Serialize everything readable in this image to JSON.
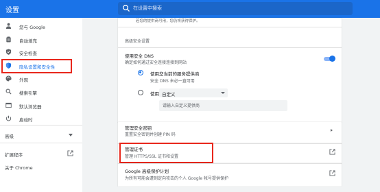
{
  "header": {
    "title": "设置",
    "search_placeholder": "在设置中搜索",
    "accent_color": "#1a73e8"
  },
  "sidebar": {
    "items": [
      {
        "label": "您与 Google",
        "icon": "person-icon"
      },
      {
        "label": "自动填充",
        "icon": "clipboard-icon"
      },
      {
        "label": "安全检查",
        "icon": "shield-check-icon"
      },
      {
        "label": "隐私设置和安全性",
        "icon": "shield-icon",
        "active": true
      },
      {
        "label": "外观",
        "icon": "palette-icon"
      },
      {
        "label": "搜索引擎",
        "icon": "search-icon"
      },
      {
        "label": "默认浏览器",
        "icon": "browser-icon"
      },
      {
        "label": "启动时",
        "icon": "power-icon"
      }
    ],
    "advanced_label": "高级",
    "extensions_label": "扩展程序",
    "about_label": "关于 Chrome"
  },
  "main": {
    "top_partial_text": "若您的提供商可用，您仍将获得保护。",
    "advanced_section_heading": "高级安全设置",
    "secure_dns": {
      "title": "使用安全 DNS",
      "description": "确定如何通过安全连接连接到网站",
      "enabled": true,
      "option_current_label": "使用您当前的服务提供商",
      "option_current_sub": "安全 DNS 未必一直可用",
      "option_custom_prefix": "使用",
      "custom_select_value": "自定义",
      "custom_input_placeholder": "请输入自定义提供商"
    },
    "manage_security_keys": {
      "title": "管理安全密钥",
      "description": "重置安全密钥并创建 PIN 码"
    },
    "manage_certificates": {
      "title": "管理证书",
      "description": "管理 HTTPS/SSL 证书和设置"
    },
    "advanced_protection": {
      "title": "Google 高级保护计划",
      "description": "为所有可能会遭到定向攻击的个人 Google 帐号提供保护"
    }
  },
  "colors": {
    "highlight_red": "#e8271c",
    "page_background": "#f1f3f4",
    "toggle_on": "#1a73e8"
  }
}
